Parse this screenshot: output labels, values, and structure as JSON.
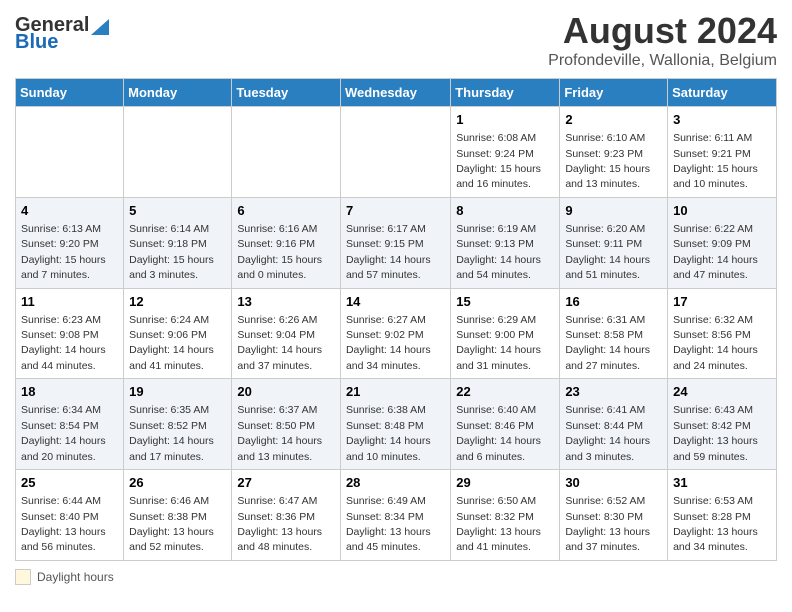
{
  "logo": {
    "general": "General",
    "blue": "Blue"
  },
  "title": "August 2024",
  "subtitle": "Profondeville, Wallonia, Belgium",
  "days_of_week": [
    "Sunday",
    "Monday",
    "Tuesday",
    "Wednesday",
    "Thursday",
    "Friday",
    "Saturday"
  ],
  "legend_label": "Daylight hours",
  "weeks": [
    [
      {
        "day": "",
        "info": ""
      },
      {
        "day": "",
        "info": ""
      },
      {
        "day": "",
        "info": ""
      },
      {
        "day": "",
        "info": ""
      },
      {
        "day": "1",
        "info": "Sunrise: 6:08 AM\nSunset: 9:24 PM\nDaylight: 15 hours and 16 minutes."
      },
      {
        "day": "2",
        "info": "Sunrise: 6:10 AM\nSunset: 9:23 PM\nDaylight: 15 hours and 13 minutes."
      },
      {
        "day": "3",
        "info": "Sunrise: 6:11 AM\nSunset: 9:21 PM\nDaylight: 15 hours and 10 minutes."
      }
    ],
    [
      {
        "day": "4",
        "info": "Sunrise: 6:13 AM\nSunset: 9:20 PM\nDaylight: 15 hours and 7 minutes."
      },
      {
        "day": "5",
        "info": "Sunrise: 6:14 AM\nSunset: 9:18 PM\nDaylight: 15 hours and 3 minutes."
      },
      {
        "day": "6",
        "info": "Sunrise: 6:16 AM\nSunset: 9:16 PM\nDaylight: 15 hours and 0 minutes."
      },
      {
        "day": "7",
        "info": "Sunrise: 6:17 AM\nSunset: 9:15 PM\nDaylight: 14 hours and 57 minutes."
      },
      {
        "day": "8",
        "info": "Sunrise: 6:19 AM\nSunset: 9:13 PM\nDaylight: 14 hours and 54 minutes."
      },
      {
        "day": "9",
        "info": "Sunrise: 6:20 AM\nSunset: 9:11 PM\nDaylight: 14 hours and 51 minutes."
      },
      {
        "day": "10",
        "info": "Sunrise: 6:22 AM\nSunset: 9:09 PM\nDaylight: 14 hours and 47 minutes."
      }
    ],
    [
      {
        "day": "11",
        "info": "Sunrise: 6:23 AM\nSunset: 9:08 PM\nDaylight: 14 hours and 44 minutes."
      },
      {
        "day": "12",
        "info": "Sunrise: 6:24 AM\nSunset: 9:06 PM\nDaylight: 14 hours and 41 minutes."
      },
      {
        "day": "13",
        "info": "Sunrise: 6:26 AM\nSunset: 9:04 PM\nDaylight: 14 hours and 37 minutes."
      },
      {
        "day": "14",
        "info": "Sunrise: 6:27 AM\nSunset: 9:02 PM\nDaylight: 14 hours and 34 minutes."
      },
      {
        "day": "15",
        "info": "Sunrise: 6:29 AM\nSunset: 9:00 PM\nDaylight: 14 hours and 31 minutes."
      },
      {
        "day": "16",
        "info": "Sunrise: 6:31 AM\nSunset: 8:58 PM\nDaylight: 14 hours and 27 minutes."
      },
      {
        "day": "17",
        "info": "Sunrise: 6:32 AM\nSunset: 8:56 PM\nDaylight: 14 hours and 24 minutes."
      }
    ],
    [
      {
        "day": "18",
        "info": "Sunrise: 6:34 AM\nSunset: 8:54 PM\nDaylight: 14 hours and 20 minutes."
      },
      {
        "day": "19",
        "info": "Sunrise: 6:35 AM\nSunset: 8:52 PM\nDaylight: 14 hours and 17 minutes."
      },
      {
        "day": "20",
        "info": "Sunrise: 6:37 AM\nSunset: 8:50 PM\nDaylight: 14 hours and 13 minutes."
      },
      {
        "day": "21",
        "info": "Sunrise: 6:38 AM\nSunset: 8:48 PM\nDaylight: 14 hours and 10 minutes."
      },
      {
        "day": "22",
        "info": "Sunrise: 6:40 AM\nSunset: 8:46 PM\nDaylight: 14 hours and 6 minutes."
      },
      {
        "day": "23",
        "info": "Sunrise: 6:41 AM\nSunset: 8:44 PM\nDaylight: 14 hours and 3 minutes."
      },
      {
        "day": "24",
        "info": "Sunrise: 6:43 AM\nSunset: 8:42 PM\nDaylight: 13 hours and 59 minutes."
      }
    ],
    [
      {
        "day": "25",
        "info": "Sunrise: 6:44 AM\nSunset: 8:40 PM\nDaylight: 13 hours and 56 minutes."
      },
      {
        "day": "26",
        "info": "Sunrise: 6:46 AM\nSunset: 8:38 PM\nDaylight: 13 hours and 52 minutes."
      },
      {
        "day": "27",
        "info": "Sunrise: 6:47 AM\nSunset: 8:36 PM\nDaylight: 13 hours and 48 minutes."
      },
      {
        "day": "28",
        "info": "Sunrise: 6:49 AM\nSunset: 8:34 PM\nDaylight: 13 hours and 45 minutes."
      },
      {
        "day": "29",
        "info": "Sunrise: 6:50 AM\nSunset: 8:32 PM\nDaylight: 13 hours and 41 minutes."
      },
      {
        "day": "30",
        "info": "Sunrise: 6:52 AM\nSunset: 8:30 PM\nDaylight: 13 hours and 37 minutes."
      },
      {
        "day": "31",
        "info": "Sunrise: 6:53 AM\nSunset: 8:28 PM\nDaylight: 13 hours and 34 minutes."
      }
    ]
  ]
}
